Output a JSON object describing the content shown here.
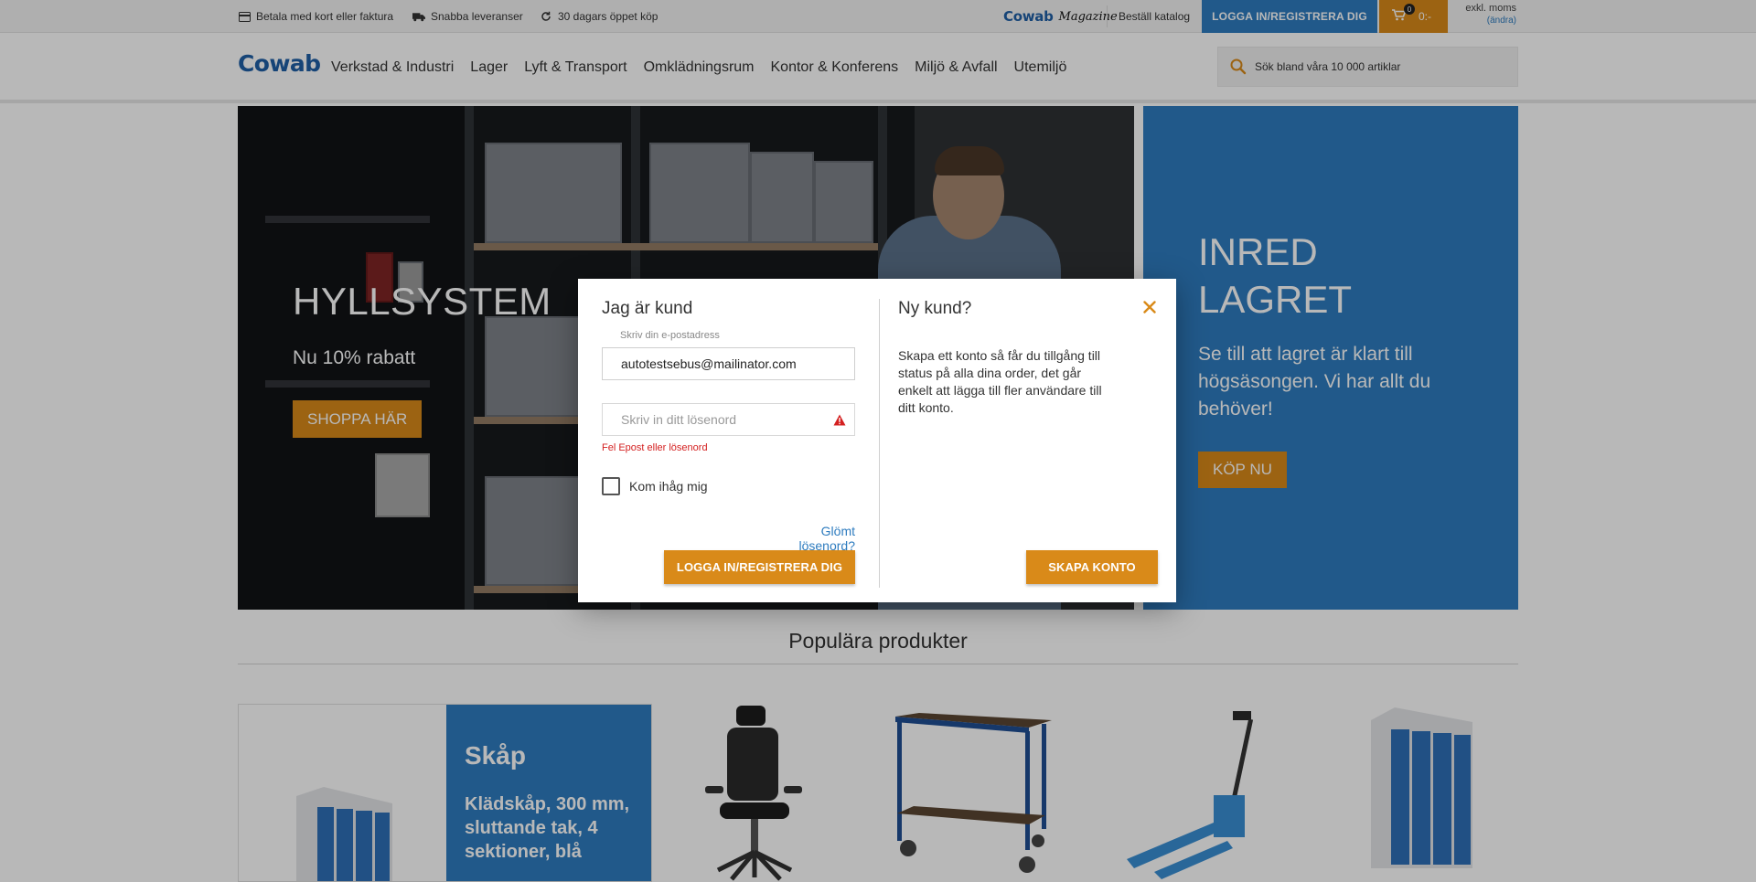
{
  "topbar": {
    "usps": [
      {
        "icon": "credit-card-icon",
        "label": "Betala med kort eller faktura"
      },
      {
        "icon": "truck-icon",
        "label": "Snabba leveranser"
      },
      {
        "icon": "refresh-icon",
        "label": "30 dagars öppet köp"
      }
    ],
    "magazine": {
      "brand": "Cowab",
      "script": "Magazine"
    },
    "catalog_link": "Beställ katalog",
    "login_label": "LOGGA IN/REGISTRERA DIG",
    "cart": {
      "count": "0",
      "total": "0:-"
    },
    "vat": {
      "label": "exkl. moms",
      "change": "(ändra)"
    }
  },
  "header": {
    "logo": "Cowab",
    "nav": [
      "Verkstad & Industri",
      "Lager",
      "Lyft & Transport",
      "Omklädningsrum",
      "Kontor & Konferens",
      "Miljö & Avfall",
      "Utemiljö"
    ],
    "search_placeholder": "Sök bland våra 10 000 artiklar"
  },
  "hero": {
    "left": {
      "title": "HYLLSYSTEM",
      "subtitle": "Nu 10% rabatt",
      "button": "SHOPPA HÄR"
    },
    "right": {
      "title": "INRED LAGRET",
      "subtitle": "Se till att lagret är klart till högsäsongen. Vi har allt du behöver!",
      "button": "KÖP NU"
    }
  },
  "popular": {
    "title": "Populära produkter",
    "featured": {
      "category": "Skåp",
      "name": "Klädskåp, 300 mm, sluttande tak, 4 sektioner, blå"
    }
  },
  "modal": {
    "existing": {
      "title": "Jag är kund",
      "email_label": "Skriv din e-postadress",
      "email_value": "autotestsebus@mailinator.com",
      "password_placeholder": "Skriv in ditt lösenord",
      "error": "Fel Epost eller lösenord",
      "remember": "Kom ihåg mig",
      "forgot": "Glömt lösenord?",
      "login_button": "LOGGA IN/REGISTRERA DIG"
    },
    "new": {
      "title": "Ny kund?",
      "description": "Skapa ett konto så får du tillgång till status på alla dina order, det går enkelt att lägga till fler användare till ditt konto.",
      "create_button": "SKAPA KONTO"
    }
  },
  "colors": {
    "brand_blue": "#2e7cbf",
    "accent_orange": "#d98a19",
    "error_red": "#d42020"
  }
}
